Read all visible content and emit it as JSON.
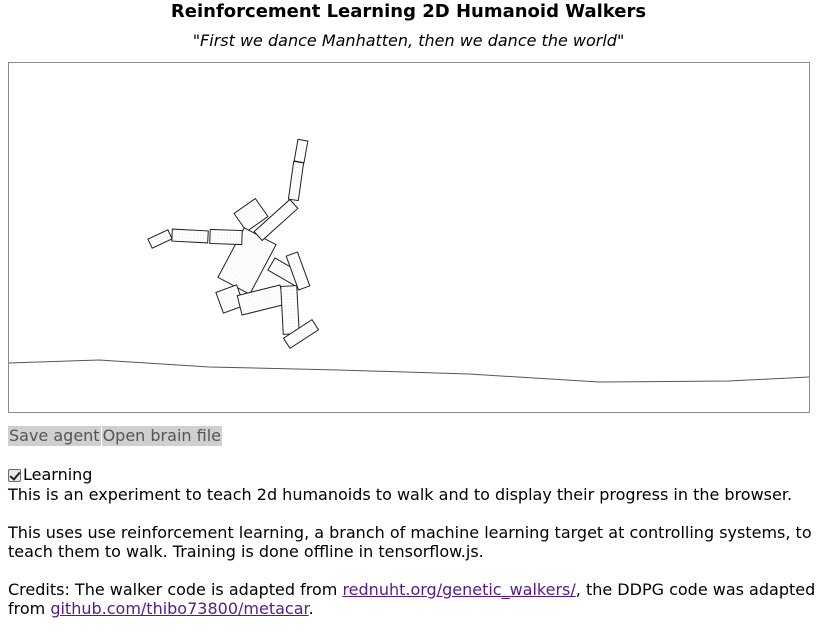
{
  "title": "Reinforcement Learning 2D Humanoid Walkers",
  "subtitle": "\"First we dance Manhatten, then we dance the world\"",
  "buttons": {
    "save": "Save agent",
    "open": "Open brain file"
  },
  "learning": {
    "label": "Learning",
    "checked": true
  },
  "intro": "This is an experiment to teach 2d humanoids to walk and to display their progress in the browser.",
  "description": "This uses use reinforcement learning, a branch of machine learning target at controlling systems, to teach them to walk. Training is done offline in tensorflow.js.",
  "credits": {
    "prefix": "Credits: The walker code is adapted from ",
    "link1": "rednuht.org/genetic_walkers/",
    "middle": ", the DDPG code was adapted from ",
    "link2": "github.com/thibo73800/metacar",
    "suffix": "."
  }
}
